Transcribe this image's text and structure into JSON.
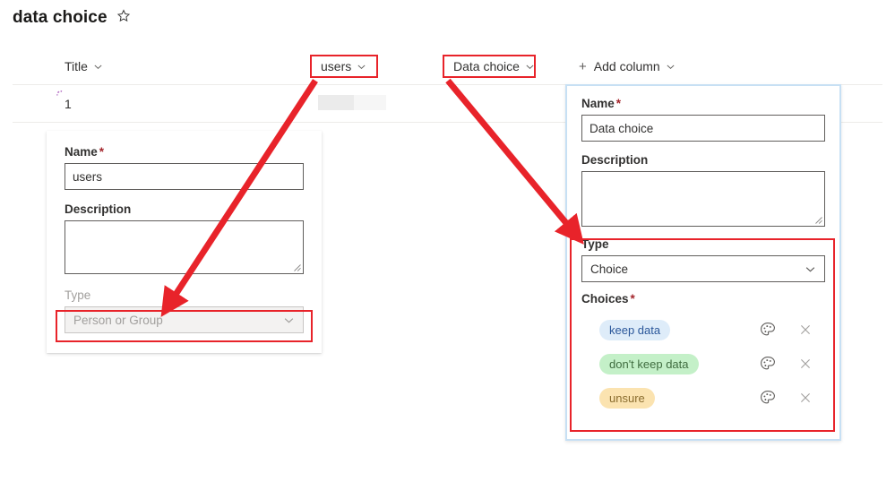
{
  "page": {
    "list_title": "data choice",
    "favorite_icon": "star-icon"
  },
  "list_header": {
    "columns": [
      {
        "label": "Title",
        "icon": "chevron-down-icon"
      },
      {
        "label": "users",
        "icon": "chevron-down-icon"
      },
      {
        "label": "Data choice",
        "icon": "chevron-down-icon"
      }
    ],
    "add_column": {
      "plus": "+",
      "label": "Add column",
      "icon": "chevron-down-icon"
    }
  },
  "rows": [
    {
      "title": "1",
      "badge_icon": "sparkle-icon"
    }
  ],
  "panels": {
    "users": {
      "name_label": "Name",
      "name_required": "*",
      "name_value": "users",
      "description_label": "Description",
      "description_value": "",
      "type_label": "Type",
      "type_value": "Person or Group",
      "type_icon": "chevron-down-icon",
      "type_disabled": true
    },
    "data_choice": {
      "name_label": "Name",
      "name_required": "*",
      "name_value": "Data choice",
      "description_label": "Description",
      "description_value": "",
      "type_label": "Type",
      "type_value": "Choice",
      "type_icon": "chevron-down-icon",
      "choices_label": "Choices",
      "choices_required": "*",
      "choices": [
        {
          "label": "keep data",
          "bg": "#deecf9",
          "fg": "#2b579a",
          "palette_icon": "palette-icon",
          "remove_icon": "close-icon"
        },
        {
          "label": "don't keep data",
          "bg": "#c4f0c8",
          "fg": "#3f6c3f",
          "palette_icon": "palette-icon",
          "remove_icon": "close-icon"
        },
        {
          "label": "unsure",
          "bg": "#fbe3b0",
          "fg": "#8a6d2f",
          "palette_icon": "palette-icon",
          "remove_icon": "close-icon"
        }
      ]
    }
  },
  "annotations": {
    "color": "#e8232a",
    "boxes": [
      "users-column-header",
      "data-choice-column-header",
      "users-type-field",
      "data-choice-type-and-choices"
    ],
    "arrows": [
      "users-header-to-type-field",
      "data-choice-header-to-type-section"
    ]
  }
}
